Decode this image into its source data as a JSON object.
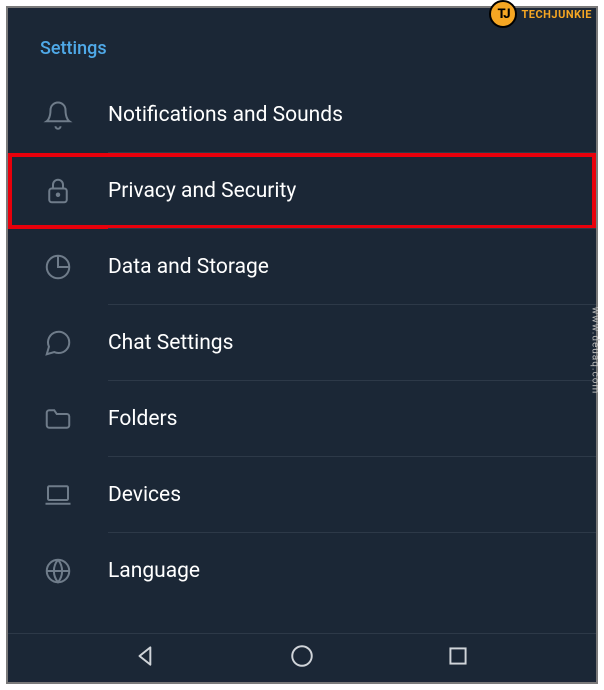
{
  "watermark": {
    "badge": "TJ",
    "brand": "TECHJUNKIE",
    "side": "www.deuaq.com"
  },
  "section_title": "Settings",
  "menu": [
    {
      "id": "notifications",
      "label": "Notifications and Sounds",
      "icon": "bell-icon",
      "highlighted": false
    },
    {
      "id": "privacy",
      "label": "Privacy and Security",
      "icon": "lock-icon",
      "highlighted": true
    },
    {
      "id": "data",
      "label": "Data and Storage",
      "icon": "pie-chart-icon",
      "highlighted": false
    },
    {
      "id": "chat",
      "label": "Chat Settings",
      "icon": "chat-icon",
      "highlighted": false
    },
    {
      "id": "folders",
      "label": "Folders",
      "icon": "folder-icon",
      "highlighted": false
    },
    {
      "id": "devices",
      "label": "Devices",
      "icon": "laptop-icon",
      "highlighted": false
    },
    {
      "id": "language",
      "label": "Language",
      "icon": "globe-icon",
      "highlighted": false
    }
  ],
  "partial_next_section": ""
}
